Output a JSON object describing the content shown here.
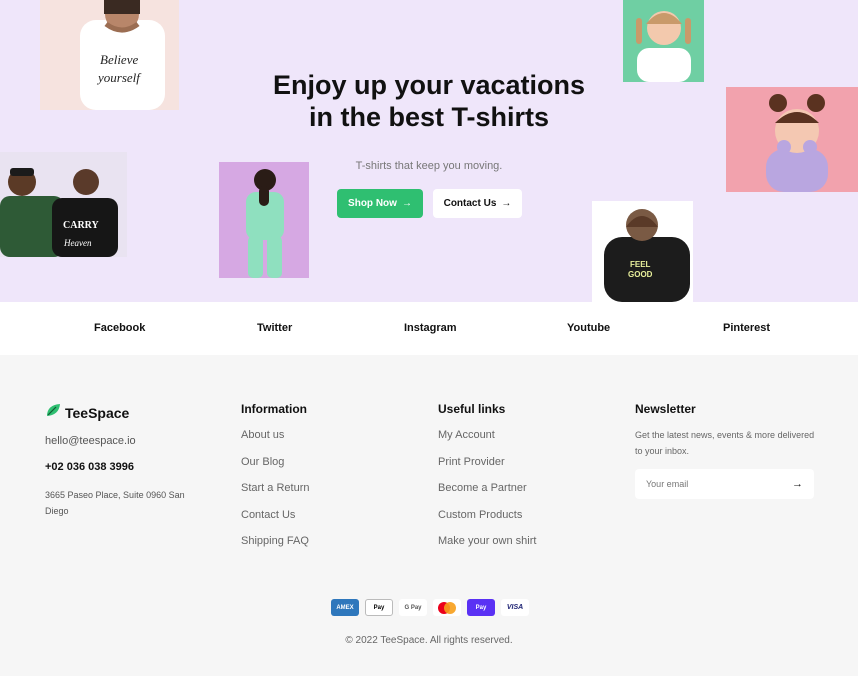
{
  "hero": {
    "title_line1": "Enjoy up your vacations",
    "title_line2": "in the best T-shirts",
    "subtitle": "T-shirts that keep you moving.",
    "shop_button": "Shop Now",
    "contact_button": "Contact Us",
    "photos": [
      {
        "name": "believe-in-yourself-tee-photo",
        "bg": "#f6e3df"
      },
      {
        "name": "girl-white-tee-photo",
        "bg": "#6fcfa3"
      },
      {
        "name": "girl-lavender-sweater-photo",
        "bg": "#f2a2ad"
      },
      {
        "name": "two-people-tees-photo",
        "bg": "#e9e3f1"
      },
      {
        "name": "green-tracksuit-photo",
        "bg": "#d6a8e3"
      },
      {
        "name": "black-hoodie-photo",
        "bg": "#ffffff"
      }
    ]
  },
  "social": [
    "Facebook",
    "Twitter",
    "Instagram",
    "Youtube",
    "Pinterest"
  ],
  "footer": {
    "brand": "TeeSpace",
    "email": "hello@teespace.io",
    "phone": "+02 036 038 3996",
    "address": "3665 Paseo Place, Suite 0960 San Diego",
    "information": {
      "title": "Information",
      "links": [
        "About us",
        "Our Blog",
        "Start a Return",
        "Contact Us",
        "Shipping FAQ"
      ]
    },
    "useful": {
      "title": "Useful links",
      "links": [
        "My Account",
        "Print Provider",
        "Become a Partner",
        "Custom Products",
        "Make your own shirt"
      ]
    },
    "newsletter": {
      "title": "Newsletter",
      "description": "Get the latest news, events & more delivered to your inbox.",
      "placeholder": "Your email"
    },
    "payments": [
      {
        "label": "AMEX",
        "icon": "amex-icon",
        "bg": "#2e77bc",
        "color": "#ffffff"
      },
      {
        "label": "Pay",
        "icon": "apple-pay-icon",
        "bg": "#ffffff",
        "color": "#000000"
      },
      {
        "label": "G Pay",
        "icon": "google-pay-icon",
        "bg": "#ffffff",
        "color": "#555555"
      },
      {
        "label": "",
        "icon": "mastercard-icon",
        "bg": "#ffffff",
        "color": "#000000"
      },
      {
        "label": "Pay",
        "icon": "shop-pay-icon",
        "bg": "#5a31f4",
        "color": "#ffffff"
      },
      {
        "label": "VISA",
        "icon": "visa-icon",
        "bg": "#ffffff",
        "color": "#1a1f71"
      }
    ],
    "copyright": "© 2022 TeeSpace. All rights reserved."
  },
  "colors": {
    "accent": "#2fbf71",
    "hero_bg": "#efe6fa",
    "footer_bg": "#f6f6f6"
  }
}
